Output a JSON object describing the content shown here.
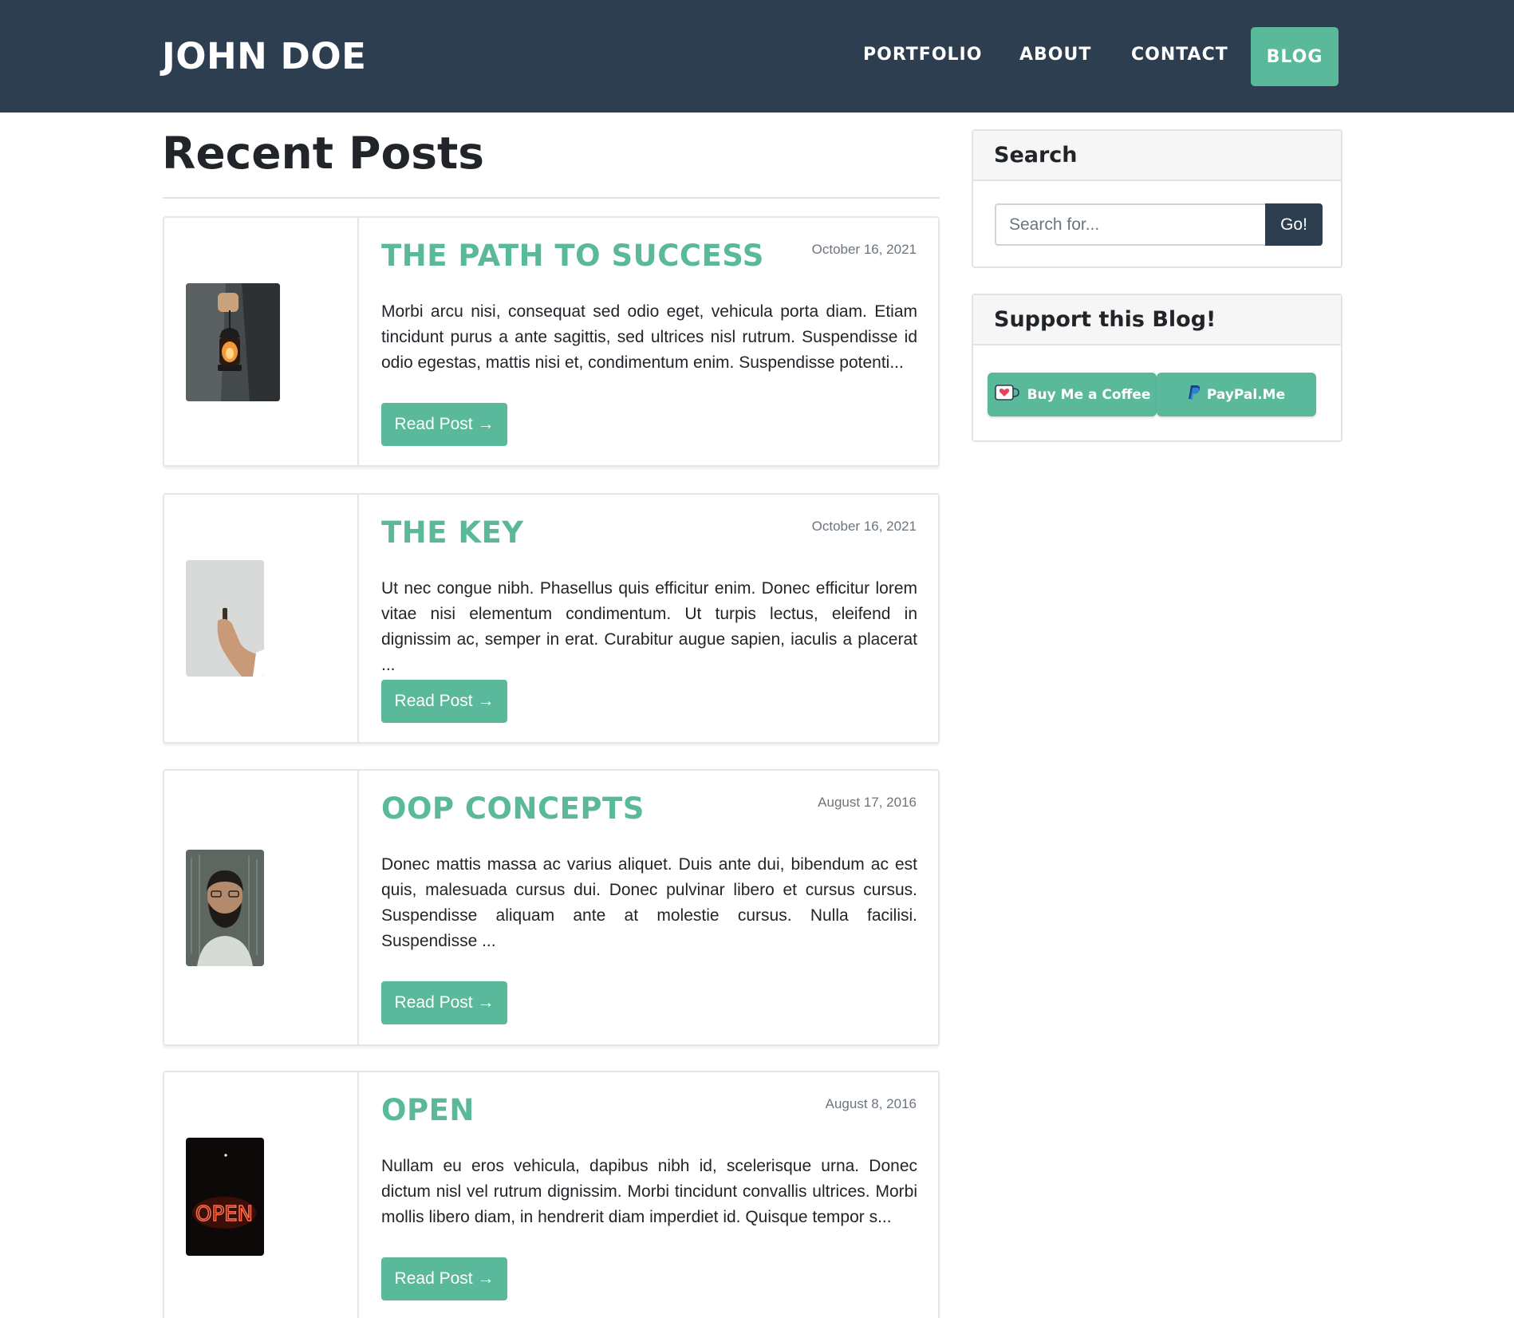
{
  "header": {
    "brand": "JOHN DOE",
    "nav": [
      "PORTFOLIO",
      "ABOUT",
      "CONTACT",
      "BLOG"
    ],
    "background_color": "#2c3e50",
    "accent_color": "#5ab99b"
  },
  "main": {
    "title": "Recent Posts",
    "posts": [
      {
        "title": "THE PATH TO SUCCESS",
        "date": "October 16, 2021",
        "excerpt": "Morbi arcu nisi, consequat sed odio eget, vehicula porta diam. Etiam tincidunt purus a ante sagittis, sed ultrices nisl rutrum. Suspendisse id odio egestas, mattis nisi et, condimentum enim. Suspendisse potenti...",
        "button": "Read Post →",
        "image": "lantern-photo"
      },
      {
        "title": "THE KEY",
        "date": "October 16, 2021",
        "excerpt": "Ut nec congue nibh. Phasellus quis efficitur enim. Donec efficitur lorem vitae nisi elementum condimentum. Ut turpis lectus, eleifend in dignissim ac, semper in erat. Curabitur augue sapien, iaculis a placerat ...",
        "button": "Read Post →",
        "image": "hand-holding-key-photo"
      },
      {
        "title": "OOP CONCEPTS",
        "date": "August 17, 2016",
        "excerpt": "Donec mattis massa ac varius aliquet. Duis ante dui, bibendum ac est quis, malesuada cursus dui. Donec pulvinar libero et cursus cursus. Suspendisse aliquam ante at molestie cursus. Nulla facilisi. Suspendisse ...",
        "button": "Read Post →",
        "image": "man-portrait-photo"
      },
      {
        "title": "OPEN",
        "date": "August 8, 2016",
        "excerpt": "Nullam eu eros vehicula, dapibus nibh id, scelerisque urna. Donec dictum nisl vel rutrum dignissim. Morbi tincidunt convallis ultrices. Morbi mollis libero diam, in hendrerit diam imperdiet id. Quisque tempor s...",
        "button": "Read Post →",
        "image": "open-neon-sign-photo"
      }
    ]
  },
  "sidebar": {
    "search": {
      "heading": "Search",
      "placeholder": "Search for...",
      "button": "Go!"
    },
    "support": {
      "heading": "Support this Blog!",
      "buttons": [
        {
          "label": "Buy Me a Coffee",
          "icon": "coffee-cup-icon"
        },
        {
          "label": "PayPal.Me",
          "icon": "paypal-icon"
        }
      ]
    }
  }
}
